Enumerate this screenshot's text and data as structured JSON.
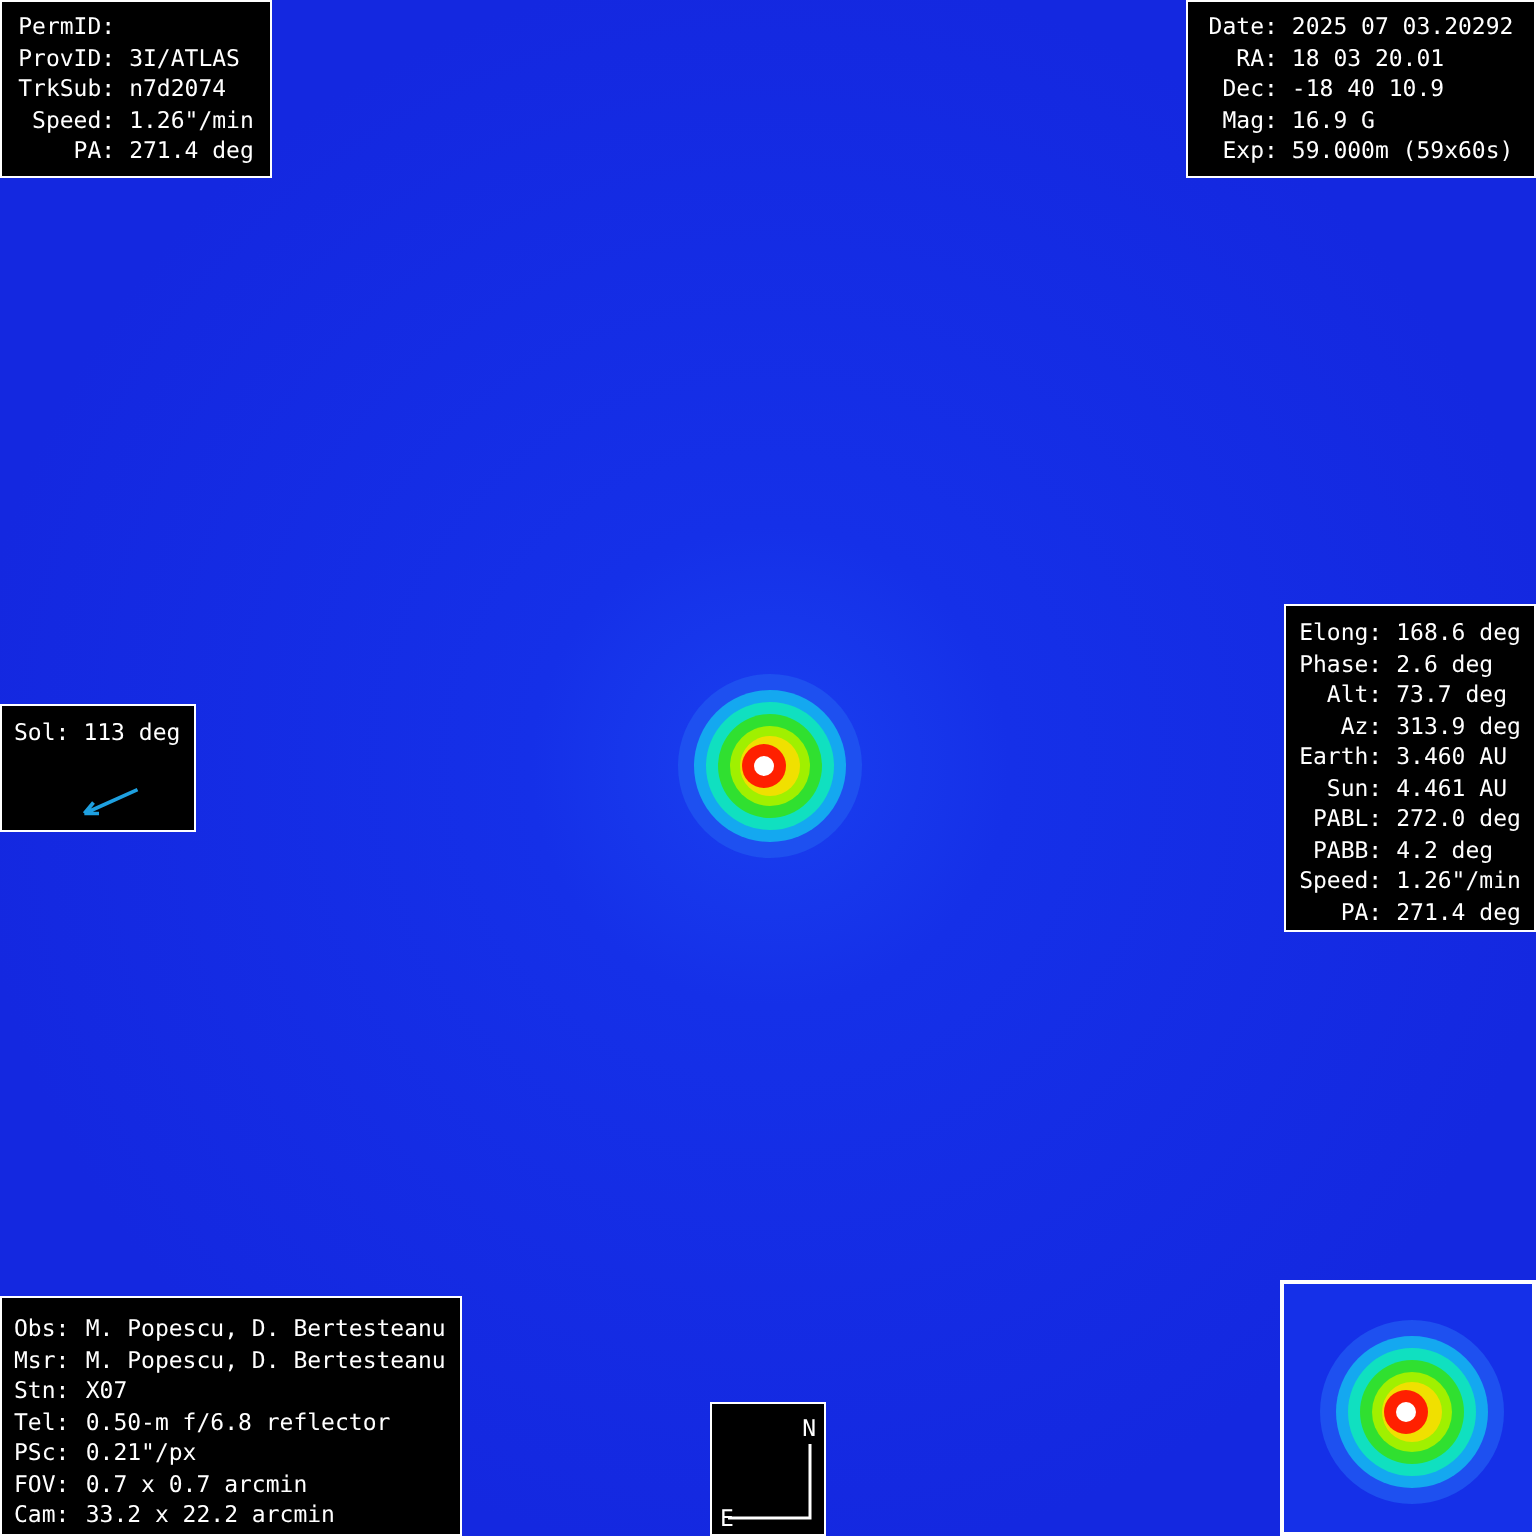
{
  "object_panel": [
    {
      "label": "PermID:"
    },
    {
      "label": "ProvID:",
      "value": "3I/ATLAS"
    },
    {
      "label": "TrkSub:",
      "value": "n7d2074"
    },
    {
      "label": "Speed:",
      "value": "1.26\"/min"
    },
    {
      "label": "PA:",
      "value": "271.4 deg"
    }
  ],
  "exposure_panel": [
    {
      "label": "Date:",
      "value": "2025 07 03.20292"
    },
    {
      "label": "RA:",
      "value": "18 03 20.01"
    },
    {
      "label": "Dec:",
      "value": "-18 40 10.9"
    },
    {
      "label": "Mag:",
      "value": "16.9 G"
    },
    {
      "label": "Exp:",
      "value": "59.000m (59x60s)"
    }
  ],
  "geometry_panel": [
    {
      "label": "Elong:",
      "value": "168.6 deg"
    },
    {
      "label": "Phase:",
      "value": "2.6 deg"
    },
    {
      "label": "Alt:",
      "value": "73.7 deg"
    },
    {
      "label": "Az:",
      "value": "313.9 deg"
    },
    {
      "label": "Earth:",
      "value": "3.460 AU"
    },
    {
      "label": "Sun:",
      "value": "4.461 AU"
    },
    {
      "label": "PABL:",
      "value": "272.0 deg"
    },
    {
      "label": "PABB:",
      "value": "4.2 deg"
    },
    {
      "label": "Speed:",
      "value": "1.26\"/min"
    },
    {
      "label": "PA:",
      "value": "271.4 deg"
    }
  ],
  "sun_panel": {
    "label": "Sol:",
    "value": "113 deg"
  },
  "observer_panel": [
    {
      "label": "Obs:",
      "value": "M. Popescu, D. Bertesteanu"
    },
    {
      "label": "Msr:",
      "value": "M. Popescu, D. Bertesteanu"
    },
    {
      "label": "Stn:",
      "value": "X07"
    },
    {
      "label": "Tel:",
      "value": "0.50-m f/6.8 reflector"
    },
    {
      "label": "PSc:",
      "value": "0.21\"/px"
    },
    {
      "label": "FOV:",
      "value": "0.7 x 0.7 arcmin"
    },
    {
      "label": "Cam:",
      "value": "33.2 x 22.2 arcmin"
    }
  ],
  "compass": {
    "north": "N",
    "east": "E"
  }
}
